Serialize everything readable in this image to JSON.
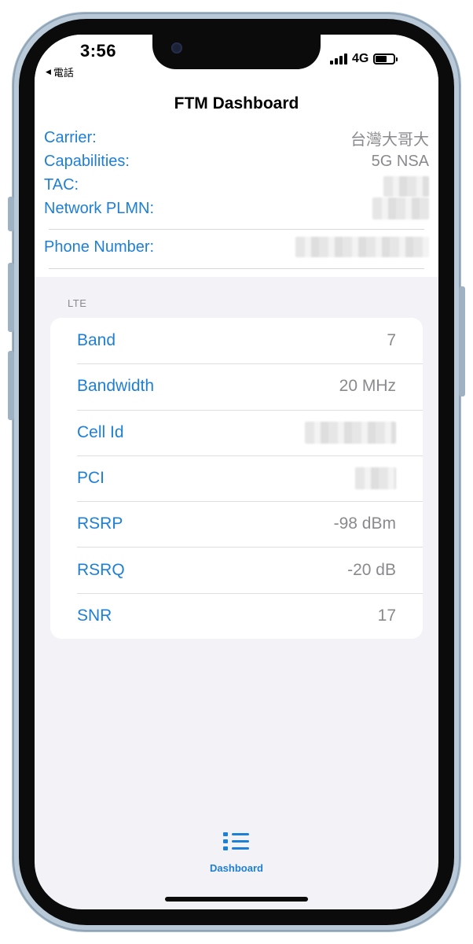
{
  "status_bar": {
    "time": "3:56",
    "back_label": "電話",
    "network": "4G"
  },
  "header": {
    "title": "FTM Dashboard"
  },
  "info": {
    "carrier_label": "Carrier:",
    "carrier_value": "台灣大哥大",
    "capabilities_label": "Capabilities:",
    "capabilities_value": "5G NSA",
    "tac_label": "TAC:",
    "plmn_label": "Network PLMN:",
    "phone_label": "Phone Number:"
  },
  "lte": {
    "header": "LTE",
    "rows": [
      {
        "label": "Band",
        "value": "7"
      },
      {
        "label": "Bandwidth",
        "value": "20 MHz"
      },
      {
        "label": "Cell Id",
        "value": ""
      },
      {
        "label": "PCI",
        "value": ""
      },
      {
        "label": "RSRP",
        "value": "-98 dBm"
      },
      {
        "label": "RSRQ",
        "value": "-20 dB"
      },
      {
        "label": "SNR",
        "value": "17"
      }
    ]
  },
  "tab_bar": {
    "dashboard_label": "Dashboard"
  },
  "colors": {
    "accent": "#1e7fd6",
    "secondary_text": "#8a8a8e",
    "grouped_background": "#f2f2f7"
  },
  "icons": {
    "tab_dashboard": "list-bullet-icon",
    "back": "back-triangle-icon"
  }
}
